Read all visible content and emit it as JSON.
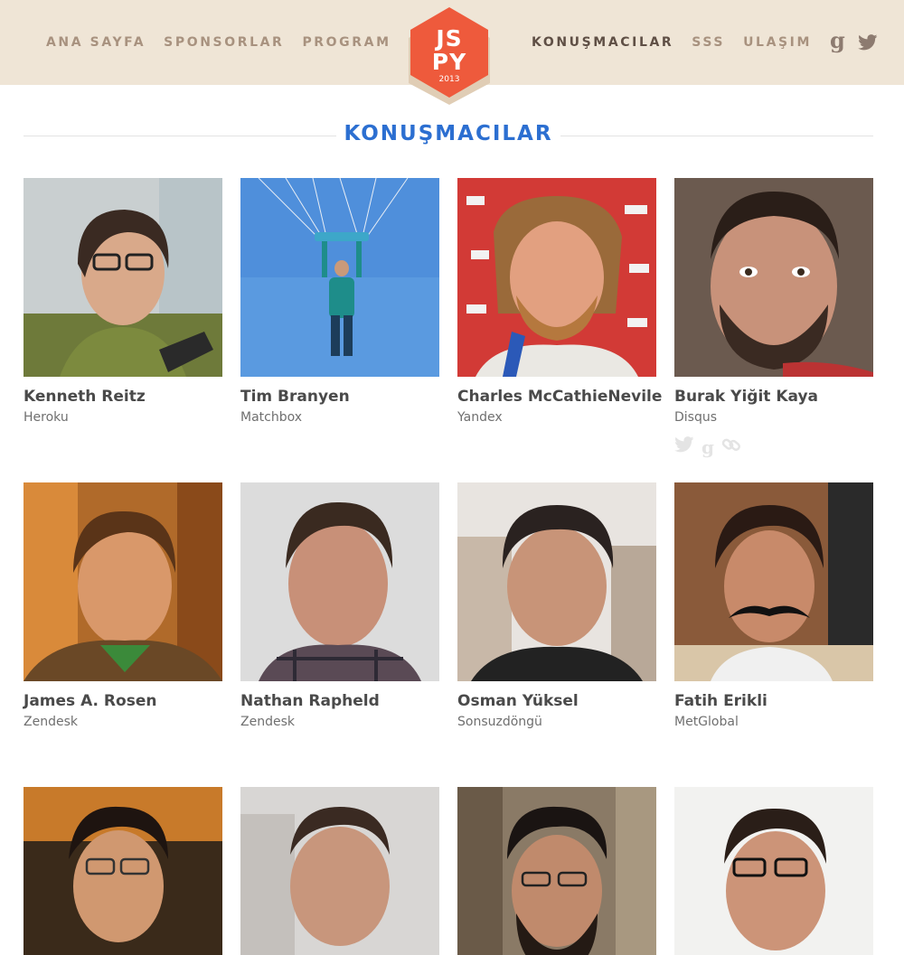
{
  "nav": {
    "left": [
      "ANA SAYFA",
      "SPONSORLAR",
      "PROGRAM"
    ],
    "right": [
      "KONUŞMACILAR",
      "SSS",
      "ULAŞIM"
    ],
    "active": "KONUŞMACILAR",
    "social": [
      "google-plus-icon",
      "twitter-icon"
    ]
  },
  "logo": {
    "line1": "JS",
    "line2": "PY",
    "year": "2013"
  },
  "section": {
    "title": "KONUŞMACILAR"
  },
  "colors": {
    "header_bg": "#efe5d6",
    "nav_text": "#a8927f",
    "nav_active": "#5f4f45",
    "logo": "#ee5a3c",
    "title": "#2c6fd1"
  },
  "speakers": [
    {
      "name": "Kenneth Reitz",
      "company": "Heroku"
    },
    {
      "name": "Tim Branyen",
      "company": "Matchbox"
    },
    {
      "name": "Charles McCathieNevile",
      "company": "Yandex"
    },
    {
      "name": "Burak Yiğit Kaya",
      "company": "Disqus",
      "social": [
        "twitter-icon",
        "google-plus-icon",
        "link-icon"
      ]
    },
    {
      "name": "James A. Rosen",
      "company": "Zendesk"
    },
    {
      "name": "Nathan Rapheld",
      "company": "Zendesk"
    },
    {
      "name": "Osman Yüksel",
      "company": "Sonsuzdöngü"
    },
    {
      "name": "Fatih Erikli",
      "company": "MetGlobal"
    },
    {
      "name": "",
      "company": ""
    },
    {
      "name": "",
      "company": ""
    },
    {
      "name": "",
      "company": ""
    },
    {
      "name": "",
      "company": ""
    }
  ]
}
